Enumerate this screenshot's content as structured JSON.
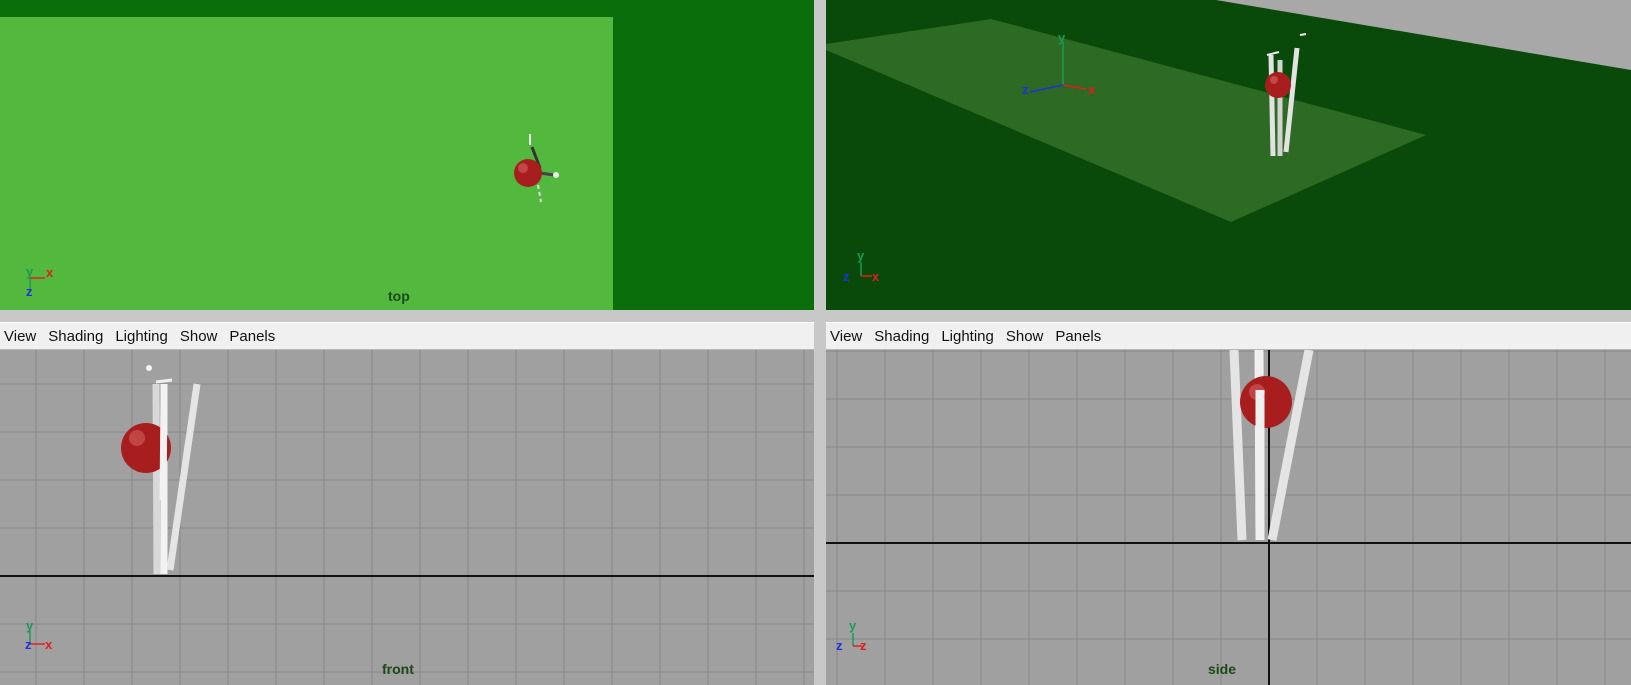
{
  "menus": {
    "view": "View",
    "shading": "Shading",
    "lighting": "Lighting",
    "show": "Show",
    "panels": "Panels"
  },
  "viewports": {
    "top": {
      "camera_label": "top",
      "axis_h": "x",
      "axis_v": "y",
      "axis_d": "z"
    },
    "persp": {
      "camera_label": "",
      "axis_h": "x",
      "axis_v": "y",
      "axis_d": "z"
    },
    "front": {
      "camera_label": "front",
      "axis_h": "x",
      "axis_v": "y",
      "axis_d": "z"
    },
    "side": {
      "camera_label": "side",
      "axis_h": "z",
      "axis_v": "y",
      "axis_d": "z"
    }
  },
  "colors": {
    "dark_grass": "#0a6f0a",
    "pitch": "#52b83e",
    "persp_grass": "#094a0a",
    "persp_pitch": "#2d6a23",
    "grid_bg": "#a0a0a0",
    "grid_line": "#888888",
    "ball": "#a81e1e",
    "stump": "#e2e2e2",
    "axis_x": "#e02020",
    "axis_y": "#1a9a55",
    "axis_z": "#2030e0"
  },
  "icons": [
    "ball-icon",
    "stumps-icon",
    "axis-gizmo-icon"
  ]
}
